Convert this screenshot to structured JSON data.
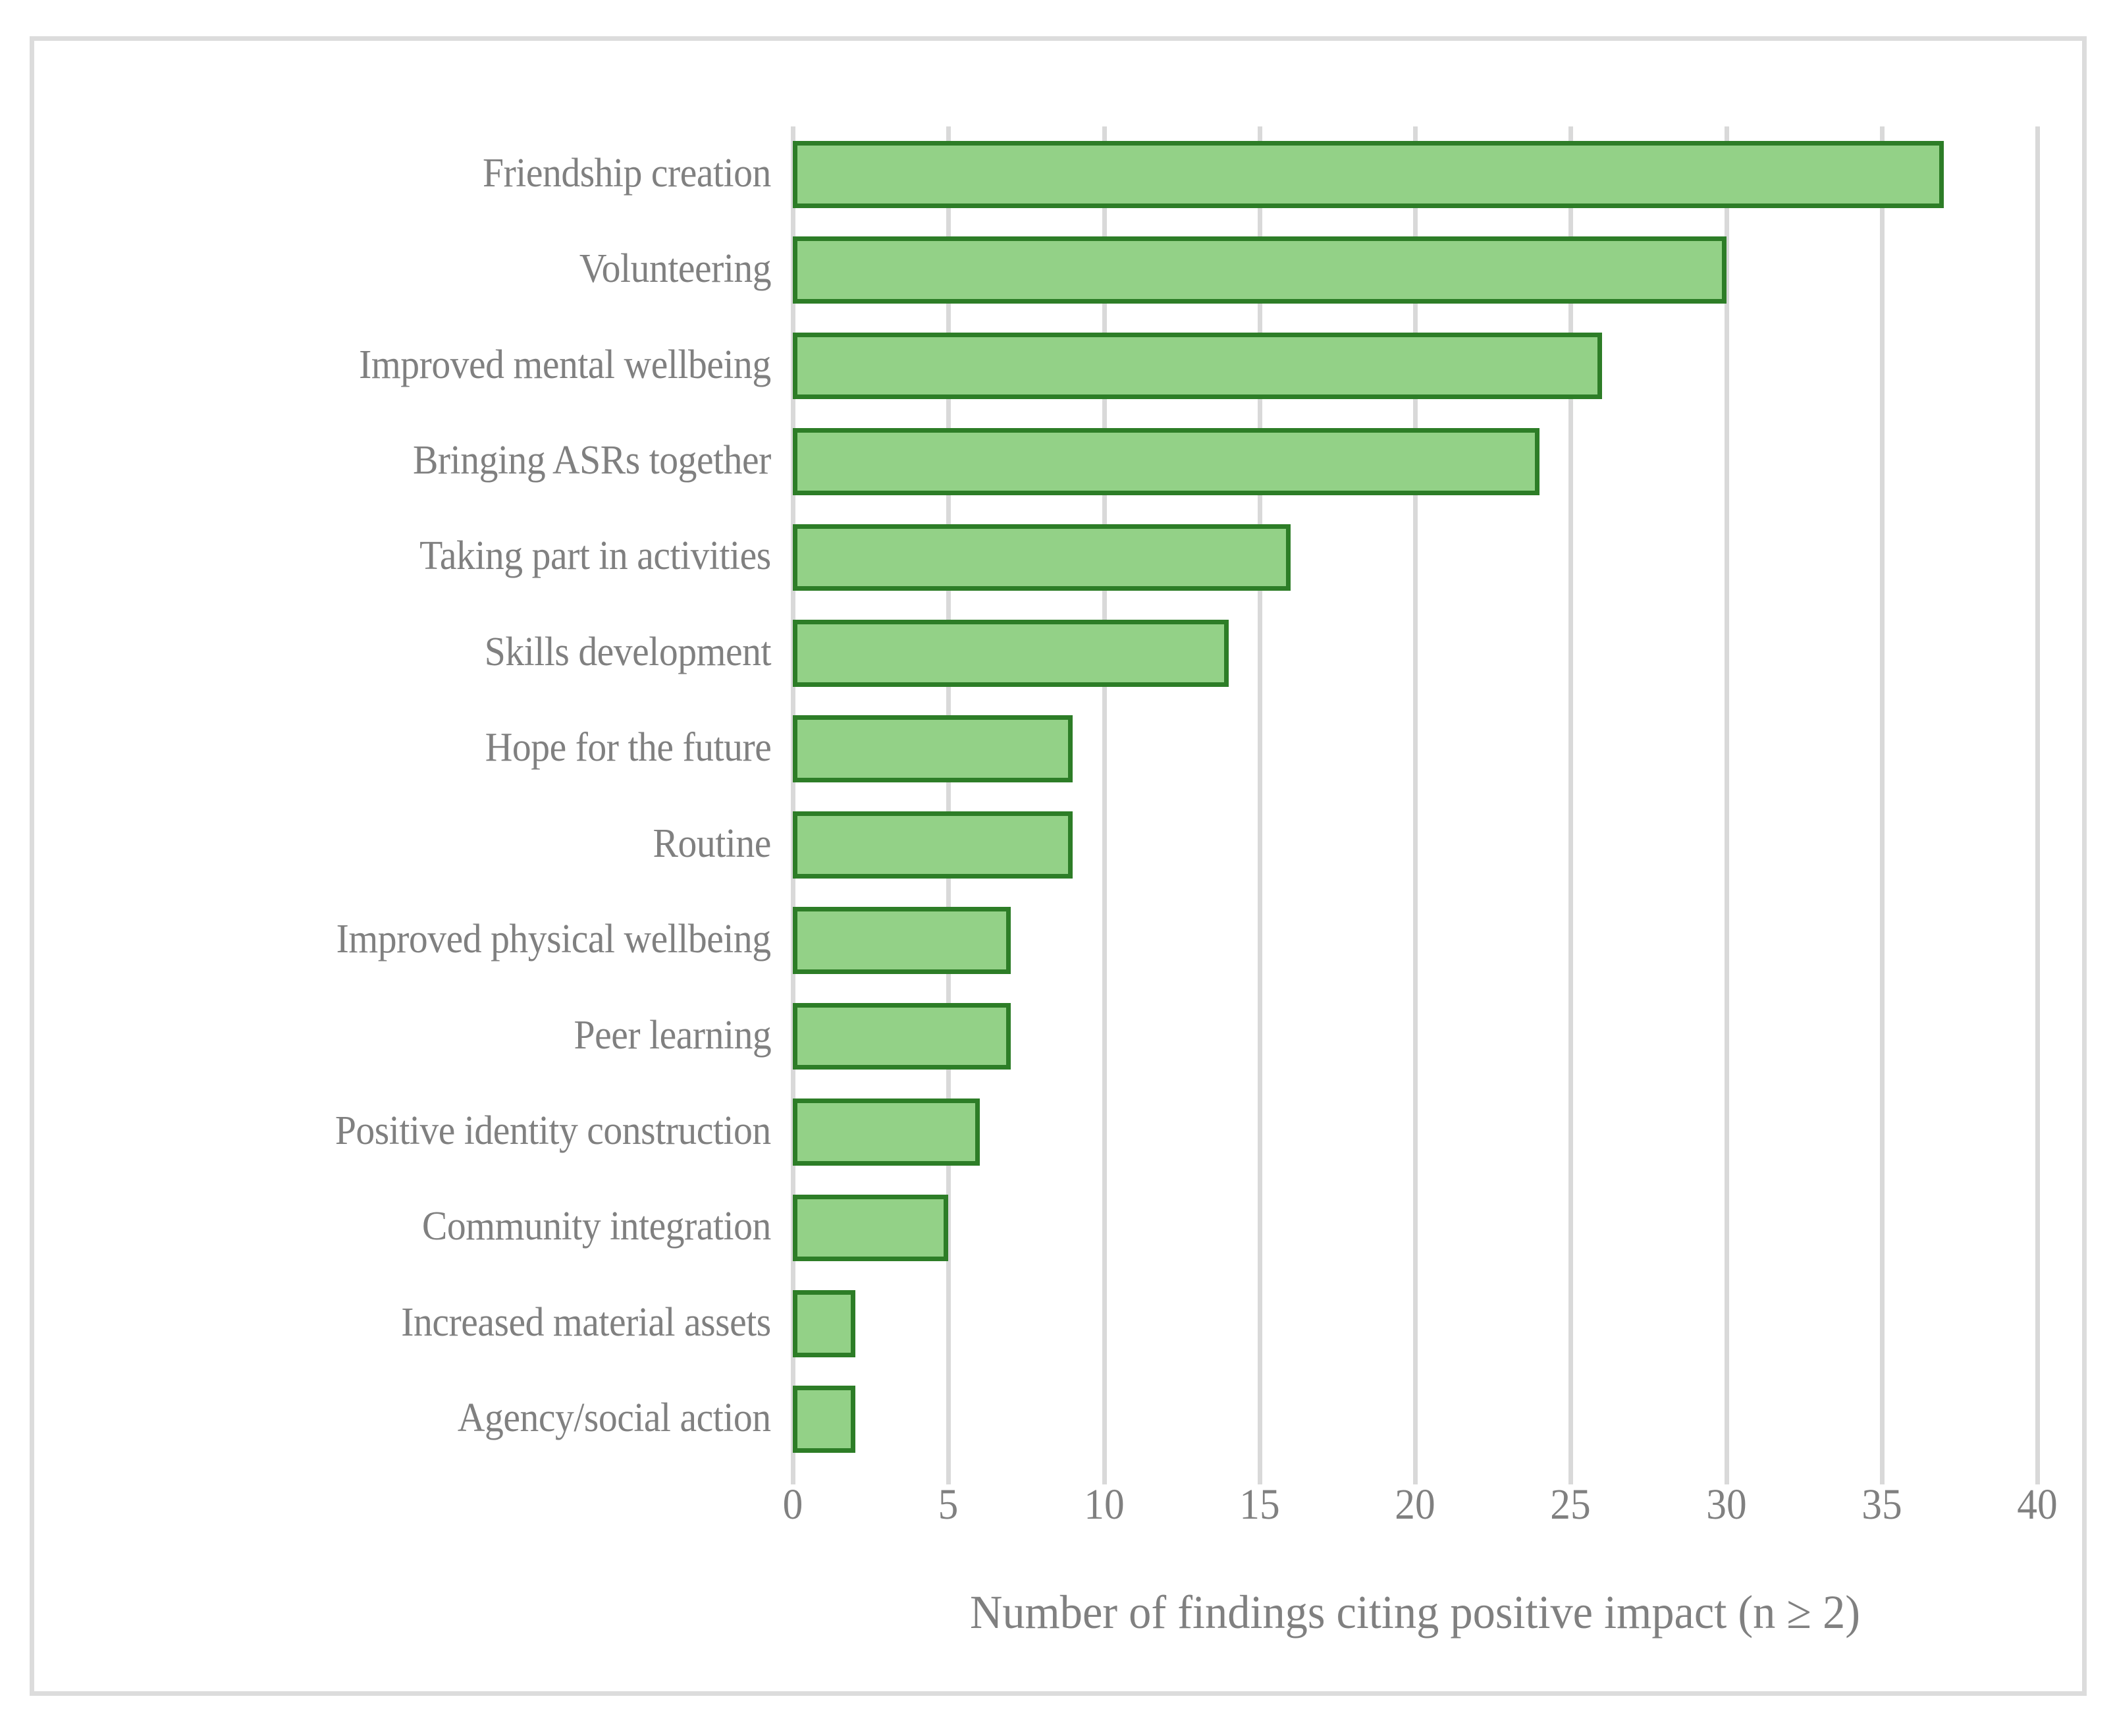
{
  "chart_data": {
    "type": "bar",
    "orientation": "horizontal",
    "title": "",
    "subtitle": "",
    "xlabel": "Number of findings citing positive impact (n ≥ 2)",
    "ylabel": "",
    "xlim": [
      0,
      40
    ],
    "xticks": [
      "0",
      "5",
      "10",
      "15",
      "20",
      "25",
      "30",
      "35",
      "40"
    ],
    "xtick_values": [
      0,
      5,
      10,
      15,
      20,
      25,
      30,
      35,
      40
    ],
    "grid": "vertical",
    "legend": "none",
    "categories": [
      "Friendship creation",
      "Volunteering",
      "Improved mental wellbeing",
      "Bringing ASRs together",
      "Taking part in activities",
      "Skills development",
      "Hope for the future",
      "Routine",
      "Improved physical wellbeing",
      "Peer learning",
      "Positive identity construction",
      "Community integration",
      "Increased material assets",
      "Agency/social action"
    ],
    "values": [
      37,
      30,
      26,
      24,
      16,
      14,
      9,
      9,
      7,
      7,
      6,
      5,
      2,
      2
    ],
    "series": [
      {
        "name": "Number of findings citing positive impact",
        "values": [
          37,
          30,
          26,
          24,
          16,
          14,
          9,
          9,
          7,
          7,
          6,
          5,
          2,
          2
        ]
      }
    ],
    "colors": {
      "bar_fill": "#93D187",
      "bar_border": "#2D7D27",
      "gridline": "#d9d9d9",
      "text": "#808080",
      "frame": "#dcdcdc",
      "background": "#ffffff"
    }
  }
}
